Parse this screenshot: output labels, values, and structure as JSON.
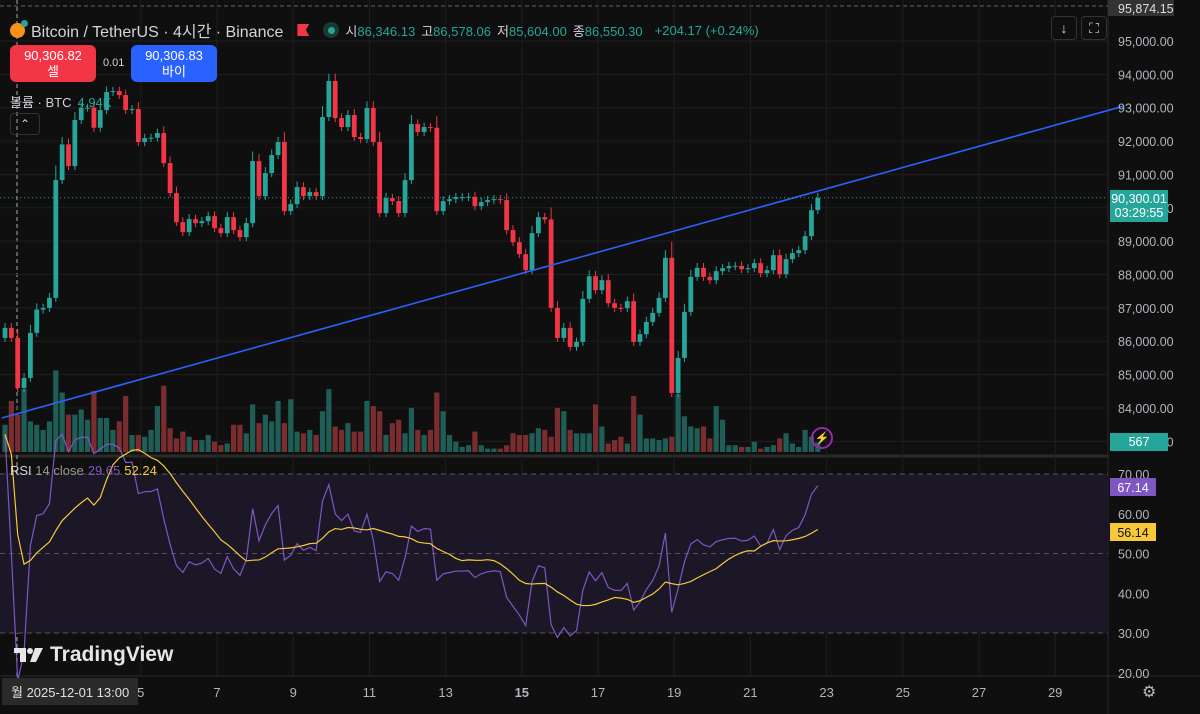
{
  "header": {
    "symbol": "Bitcoin / TetherUS · 4시간 · Binance",
    "open_label": "시",
    "open": "86,346.13",
    "high_label": "고",
    "high": "86,578.06",
    "low_label": "저",
    "low": "85,604.00",
    "close_label": "종",
    "close": "86,550.30",
    "change": "+204.17 (+0.24%)"
  },
  "trade": {
    "sell_price": "90,306.82",
    "sell_label": "셀",
    "spread": "0.01",
    "buy_price": "90,306.83",
    "buy_label": "바이"
  },
  "volume_legend": {
    "label": "볼륨 · BTC",
    "value": "4.94K"
  },
  "collapse_icon": "chevron-up",
  "collapse_glyph": "⌃",
  "toolbar": {
    "scroll_glyph": "↓",
    "fullscreen_glyph": "⛶"
  },
  "rsi_legend": {
    "label": "RSI",
    "params": "14 close",
    "value": "29.65",
    "ma_value": "52.24"
  },
  "logo": "TradingView",
  "cursor_label": "월 2025-12-01   13:00",
  "colors": {
    "up": "#26a69a",
    "down": "#f23645",
    "trendline": "#2962ff",
    "rsi": "#7e57c2",
    "rsi_ma": "#f7c93a",
    "sell": "#f23645",
    "buy": "#2962ff"
  },
  "chart_data": {
    "type": "candlestick",
    "interval": "4h",
    "first_open": 86100,
    "closes": [
      86400,
      86100,
      84600,
      84900,
      86250,
      86950,
      87000,
      87300,
      90830,
      91900,
      91250,
      92630,
      93000,
      93000,
      92400,
      92930,
      93470,
      93500,
      93380,
      92930,
      92960,
      91970,
      92090,
      92100,
      92240,
      91340,
      90440,
      89570,
      89270,
      89660,
      89540,
      89600,
      89750,
      89390,
      89240,
      89720,
      89330,
      89120,
      89540,
      91400,
      90350,
      91040,
      91580,
      91970,
      89900,
      90110,
      90620,
      90350,
      90470,
      90350,
      92720,
      93800,
      92690,
      92420,
      92780,
      92120,
      92060,
      92990,
      91970,
      89840,
      90290,
      90200,
      89840,
      90830,
      92510,
      92270,
      92420,
      92400,
      89900,
      90200,
      90260,
      90320,
      90320,
      90330,
      90050,
      90170,
      90230,
      90260,
      90230,
      89330,
      88970,
      88610,
      88130,
      89240,
      89720,
      89650,
      87000,
      86100,
      86400,
      85830,
      85980,
      87270,
      87950,
      87530,
      87830,
      87140,
      87000,
      86990,
      87200,
      85980,
      86210,
      86580,
      86850,
      87300,
      88500,
      84450,
      85500,
      86880,
      87930,
      88200,
      87930,
      87830,
      88100,
      88190,
      88250,
      88260,
      88160,
      88190,
      88340,
      88040,
      88130,
      88580,
      88010,
      88460,
      88640,
      88730,
      89150,
      89930,
      90300
    ],
    "volumes": [
      1600,
      3000,
      2200,
      3700,
      1800,
      1600,
      1300,
      1800,
      4800,
      3500,
      2200,
      2200,
      2500,
      1900,
      3600,
      2000,
      2000,
      1300,
      1800,
      3300,
      1000,
      1000,
      900,
      1300,
      2700,
      3900,
      1400,
      800,
      1200,
      900,
      700,
      700,
      1000,
      600,
      400,
      500,
      1600,
      1600,
      1100,
      2800,
      1700,
      2200,
      1800,
      3000,
      1700,
      3100,
      1200,
      1100,
      1300,
      1000,
      2400,
      3700,
      1500,
      1300,
      1700,
      1200,
      1200,
      3000,
      2700,
      2400,
      1000,
      1700,
      1900,
      1100,
      2600,
      1300,
      1000,
      1300,
      3500,
      2400,
      1000,
      600,
      300,
      400,
      1200,
      400,
      200,
      200,
      200,
      400,
      1100,
      1000,
      1000,
      1100,
      1400,
      1300,
      900,
      2600,
      2400,
      1300,
      1100,
      1100,
      1100,
      2800,
      1500,
      500,
      700,
      900,
      500,
      3300,
      2200,
      800,
      800,
      700,
      800,
      900,
      3400,
      2100,
      1500,
      1400,
      1500,
      800,
      2700,
      1900,
      400,
      400,
      300,
      300,
      600,
      200,
      300,
      400,
      800,
      1100,
      500,
      300,
      1300,
      900,
      567
    ],
    "first_candle_date": "2025-12-01",
    "trendline": {
      "start": {
        "day": 1.35,
        "price": 83700
      },
      "end": {
        "day": 30.8,
        "price": 93050
      }
    },
    "price_axis": {
      "ticks": [
        "95,000.00",
        "94,000.00",
        "93,000.00",
        "92,000.00",
        "91,000.00",
        "90,000.00",
        "89,000.00",
        "88,000.00",
        "87,000.00",
        "86,000.00",
        "85,000.00",
        "84,000.00",
        "83,000.00"
      ],
      "ylim": [
        83000,
        95900
      ],
      "crosshair_price": "95,874.15",
      "last_price": "90,300.01",
      "countdown": "03:29:55",
      "last_volume": "567"
    },
    "time_axis": {
      "ticks": [
        "5",
        "7",
        "9",
        "11",
        "13",
        "15",
        "17",
        "19",
        "21",
        "23",
        "25",
        "27",
        "29"
      ],
      "tick_days": [
        5,
        7,
        9,
        11,
        13,
        15,
        17,
        19,
        21,
        23,
        25,
        27,
        29
      ]
    },
    "rsi": {
      "period": 14,
      "ma_period": 14,
      "ticks": [
        "70.00",
        "60.00",
        "50.00",
        "40.00",
        "30.00",
        "20.00"
      ],
      "tick_values": [
        70,
        60,
        50,
        40,
        30,
        20
      ],
      "band": [
        30,
        70
      ],
      "last_rsi": "67.14",
      "last_ma": "56.14"
    }
  }
}
